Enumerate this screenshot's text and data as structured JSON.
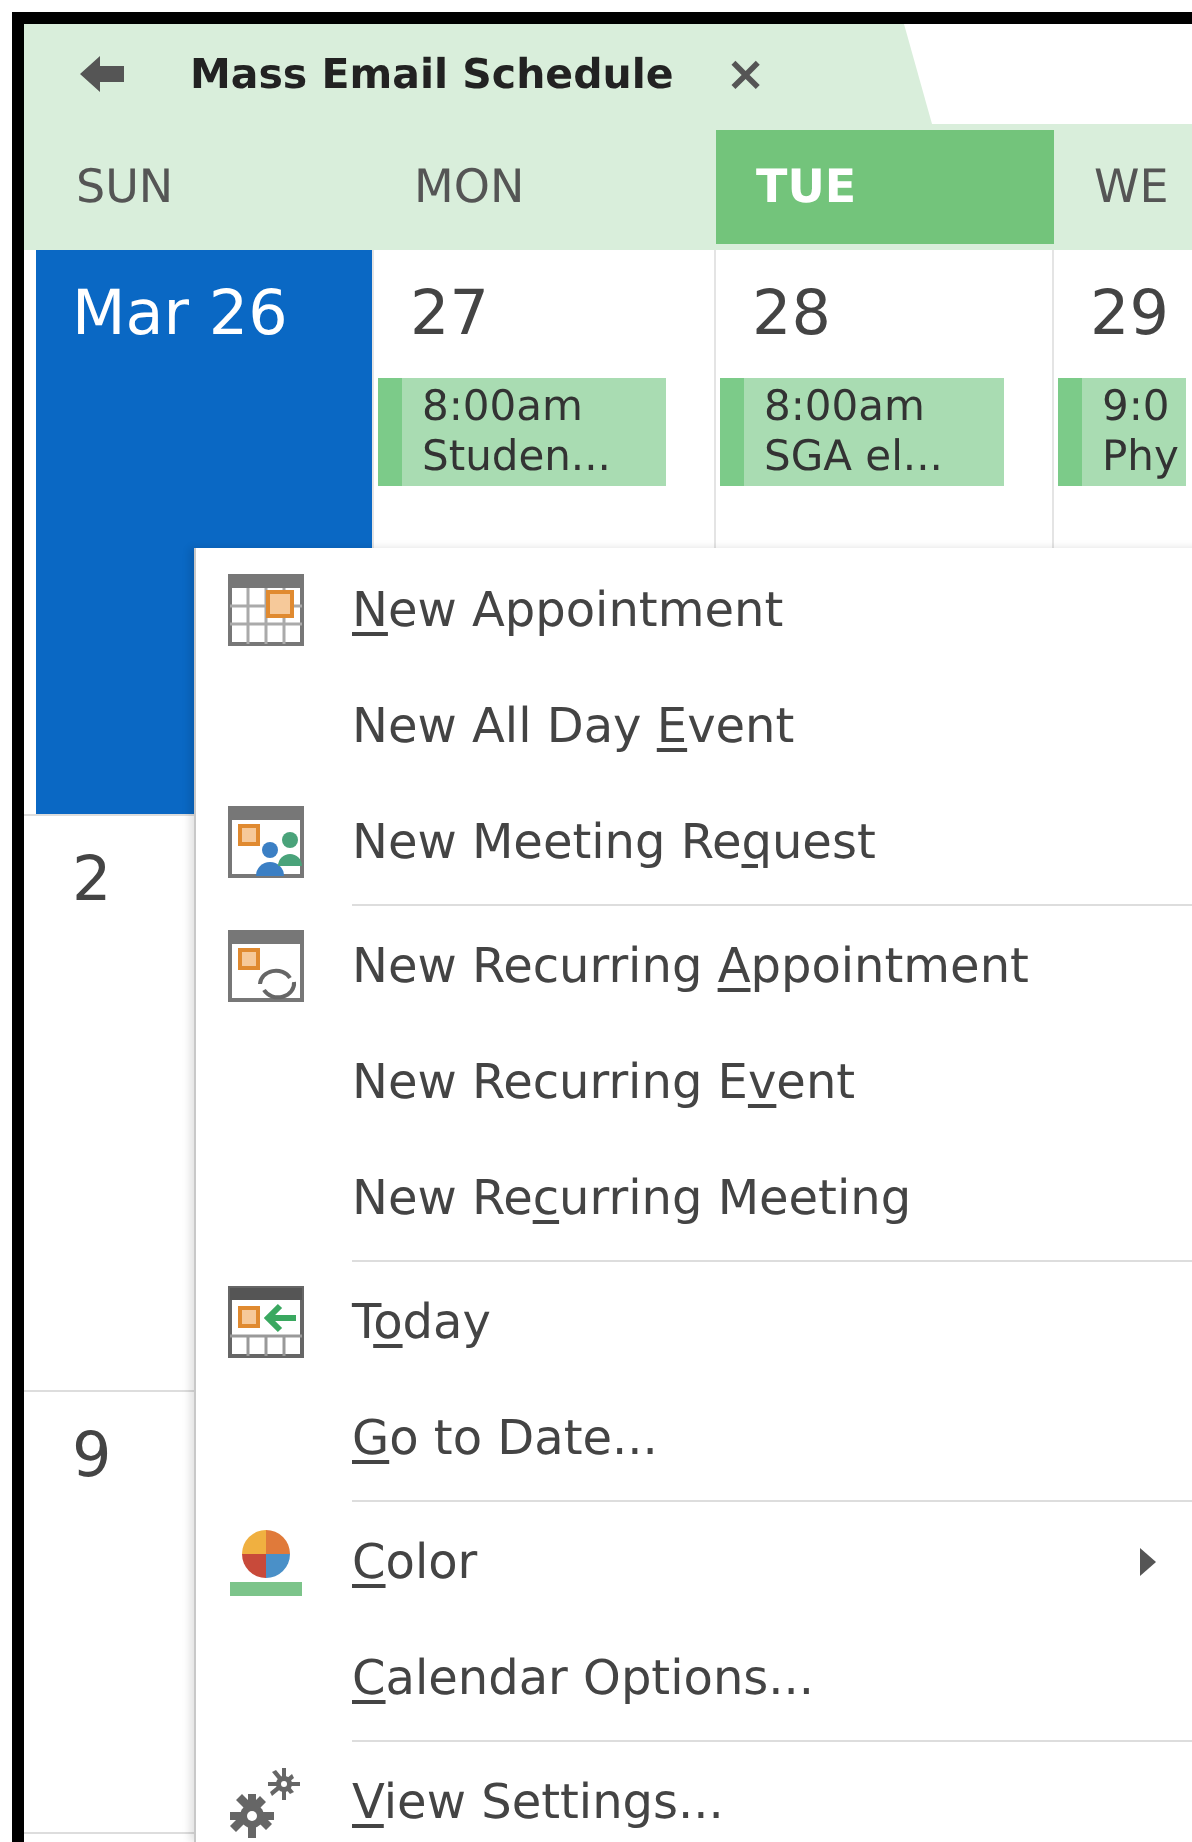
{
  "tab": {
    "title": "Mass Email Schedule",
    "close": "×"
  },
  "days": [
    {
      "label": "SUN",
      "selected": false
    },
    {
      "label": "MON",
      "selected": false
    },
    {
      "label": "TUE",
      "selected": true
    },
    {
      "label": "WE",
      "selected": false
    }
  ],
  "weeks": [
    {
      "cells": [
        {
          "date": "Mar 26",
          "selected": true
        },
        {
          "date": "27",
          "selected": false,
          "events": [
            {
              "time": "8:00am",
              "title": "Studen..."
            }
          ]
        },
        {
          "date": "28",
          "selected": false,
          "events": [
            {
              "time": "8:00am",
              "title": "SGA el..."
            }
          ]
        },
        {
          "date": "29",
          "selected": false,
          "events": [
            {
              "time": "9:0",
              "title": "Phy"
            }
          ]
        }
      ]
    },
    {
      "cells": [
        {
          "date": "2",
          "selected": false
        }
      ]
    },
    {
      "cells": [
        {
          "date": "9",
          "selected": false
        }
      ]
    }
  ],
  "menu": [
    {
      "kind": "item",
      "key": "N",
      "post": "ew Appointment",
      "has_submenu": false
    },
    {
      "kind": "item",
      "pre": "New All Day ",
      "key": "E",
      "post": "vent",
      "has_submenu": false
    },
    {
      "kind": "item",
      "pre": "New Meeting Re",
      "key": "q",
      "post": "uest",
      "has_submenu": false
    },
    {
      "kind": "separator"
    },
    {
      "kind": "item",
      "pre": "New Recurring ",
      "key": "A",
      "post": "ppointment",
      "has_submenu": false
    },
    {
      "kind": "item",
      "pre": "New Recurring E",
      "key": "v",
      "post": "ent",
      "has_submenu": false
    },
    {
      "kind": "item",
      "pre": "New Re",
      "key": "c",
      "post": "urring Meeting",
      "has_submenu": false
    },
    {
      "kind": "separator"
    },
    {
      "kind": "item",
      "pre": "T",
      "key": "o",
      "post": "day",
      "has_submenu": false
    },
    {
      "kind": "item",
      "key": "G",
      "post": "o to Date...",
      "has_submenu": false
    },
    {
      "kind": "separator"
    },
    {
      "kind": "item",
      "key": "C",
      "post": "olor",
      "has_submenu": true
    },
    {
      "kind": "item",
      "key": "C",
      "post": "alendar Options...",
      "has_submenu": false
    },
    {
      "kind": "separator"
    },
    {
      "kind": "item",
      "key": "V",
      "post": "iew Settings...",
      "has_submenu": false
    }
  ]
}
